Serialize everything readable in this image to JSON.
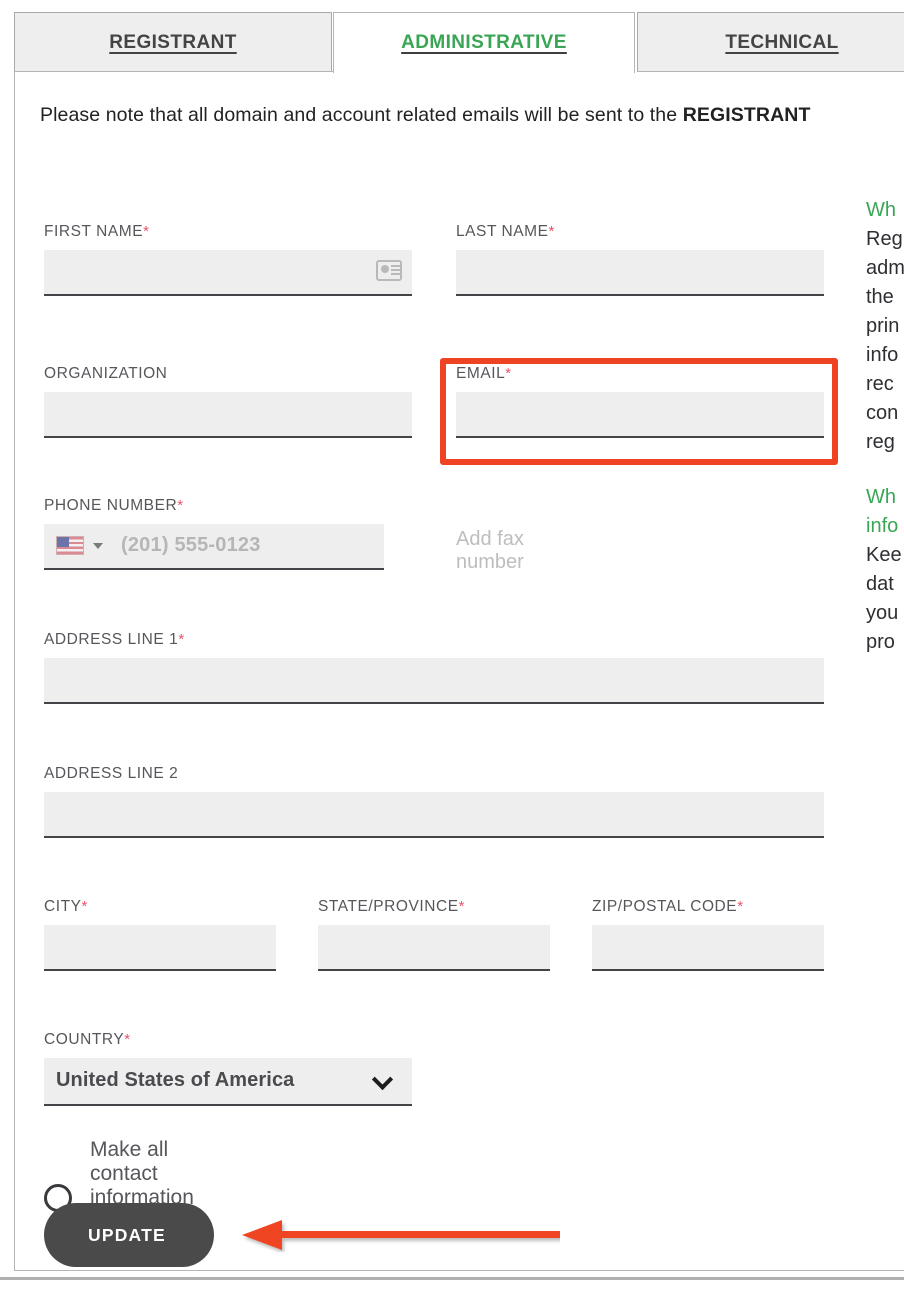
{
  "tabs": [
    {
      "id": "registrant",
      "label": "REGISTRANT",
      "active": false
    },
    {
      "id": "administrative",
      "label": "ADMINISTRATIVE",
      "active": true
    },
    {
      "id": "technical",
      "label": "TECHNICAL",
      "active": false
    }
  ],
  "notice": {
    "prefix": "Please note that all domain and account related emails will be sent to the ",
    "emphasis": "REGISTRANT"
  },
  "form": {
    "first_name": {
      "label": "FIRST NAME",
      "required": true,
      "value": "",
      "placeholder": ""
    },
    "last_name": {
      "label": "LAST NAME",
      "required": true,
      "value": "",
      "placeholder": ""
    },
    "organization": {
      "label": "ORGANIZATION",
      "required": false,
      "value": "",
      "placeholder": ""
    },
    "email": {
      "label": "EMAIL",
      "required": true,
      "value": "",
      "placeholder": ""
    },
    "phone": {
      "label": "PHONE NUMBER",
      "required": true,
      "value": "",
      "placeholder": "(201) 555-0123",
      "country_flag": "us-flag"
    },
    "fax_link": "Add fax number",
    "address1": {
      "label": "ADDRESS LINE 1",
      "required": true,
      "value": "",
      "placeholder": ""
    },
    "address2": {
      "label": "ADDRESS LINE 2",
      "required": false,
      "value": "",
      "placeholder": ""
    },
    "city": {
      "label": "CITY",
      "required": true,
      "value": "",
      "placeholder": ""
    },
    "state": {
      "label": "STATE/PROVINCE",
      "required": true,
      "value": "",
      "placeholder": ""
    },
    "zip": {
      "label": "ZIP/POSTAL CODE",
      "required": true,
      "value": "",
      "placeholder": ""
    },
    "country": {
      "label": "COUNTRY",
      "required": true,
      "selected": "United States of America"
    },
    "same_as_admin": {
      "label": "Make all contact information the same as Admin.",
      "checked": false
    },
    "submit": "UPDATE",
    "required_marker": "*"
  },
  "help": {
    "block1": {
      "title": "Wh",
      "body": "Reg\nadm\nthe\nprin\ninfo\nrec\ncon\nreg"
    },
    "block2": {
      "title": "Wh\ninfo",
      "body": "Kee\ndat\nyou\npro"
    }
  },
  "colors": {
    "accent_green": "#3aa655",
    "annotation_red": "#ef4423",
    "required_red": "#e8546a",
    "button_dark": "#4a4a4a",
    "field_bg": "#eeeeee"
  }
}
